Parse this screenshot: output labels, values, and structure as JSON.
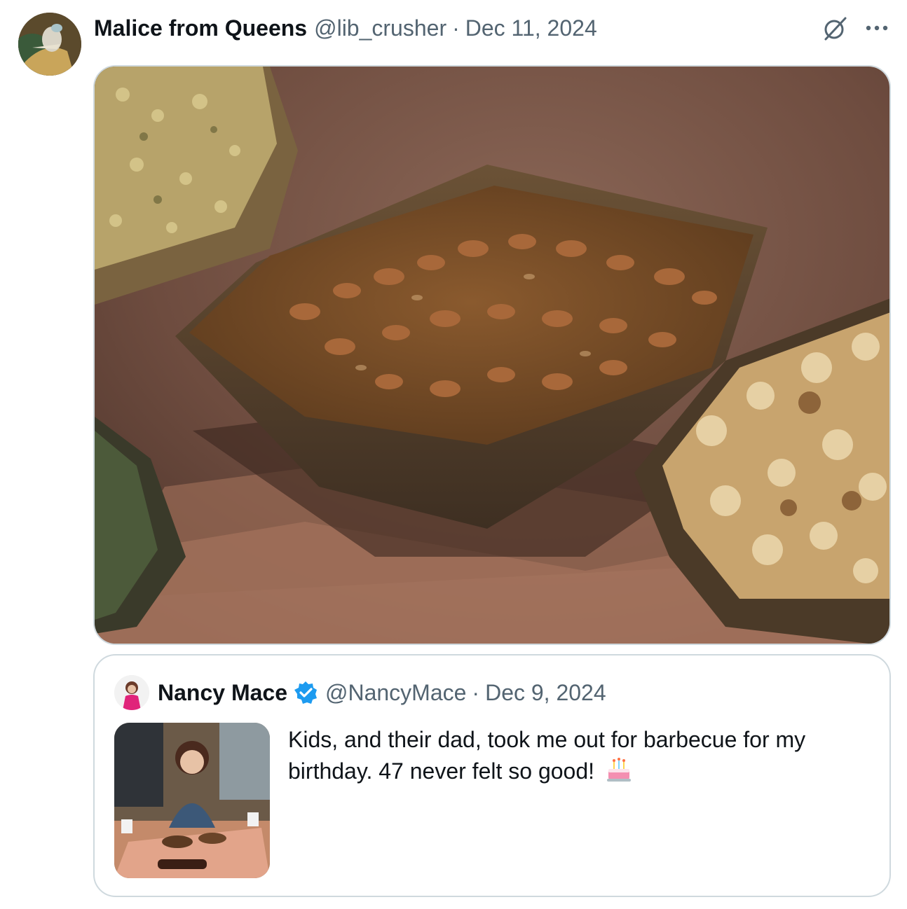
{
  "tweet": {
    "author_name": "Malice from Queens",
    "author_handle": "@lib_crusher",
    "separator": "·",
    "date": "Dec 11, 2024",
    "icons": [
      "grok-icon",
      "more-icon"
    ],
    "media_description_icon": "photo-beans"
  },
  "quote": {
    "author_name": "Nancy Mace",
    "author_handle": "@NancyMace",
    "separator": "·",
    "date": "Dec 9, 2024",
    "text": "Kids, and their dad, took me out for barbecue for my birthday. 47 never felt so good!",
    "emoji_icon": "birthday-cake-icon",
    "verified_color": "#1d9bf0"
  }
}
